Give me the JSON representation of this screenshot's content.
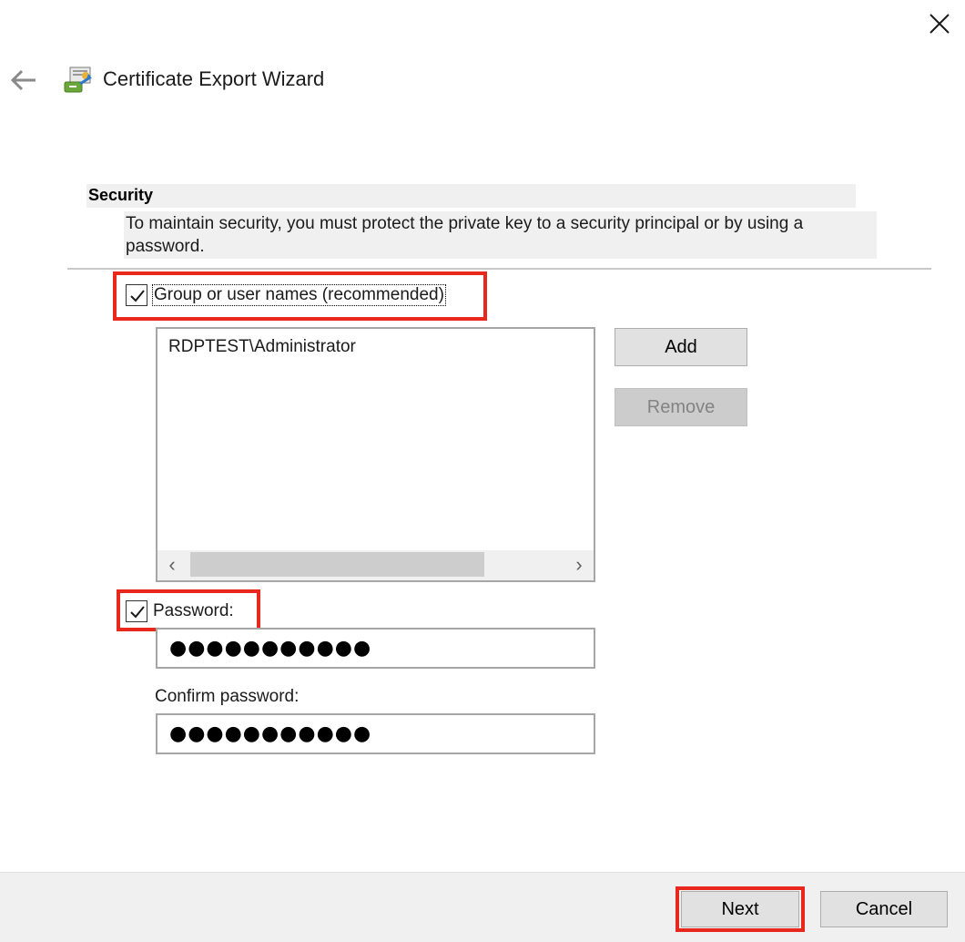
{
  "window": {
    "title": "Certificate Export Wizard",
    "back_icon": "back-arrow-icon",
    "close_icon": "close-icon",
    "app_icon": "certificate-wizard-icon"
  },
  "section": {
    "heading": "Security",
    "description": "To maintain security, you must protect the private key to a security principal or by using a password."
  },
  "group_option": {
    "label": "Group or user names (recommended)",
    "checked": true
  },
  "principals": {
    "items": [
      "RDPTEST\\Administrator"
    ],
    "scroll_left_icon": "chevron-left-icon",
    "scroll_right_icon": "chevron-right-icon"
  },
  "buttons": {
    "add": "Add",
    "remove": "Remove",
    "next": "Next",
    "cancel": "Cancel"
  },
  "password_option": {
    "label": "Password:",
    "checked": true,
    "value": "●●●●●●●●●●●"
  },
  "confirm": {
    "label": "Confirm password:",
    "value": "●●●●●●●●●●●"
  },
  "colors": {
    "highlight": "#e8281c",
    "panel_bg": "#f0f0f0",
    "button_bg": "#e1e1e1"
  }
}
